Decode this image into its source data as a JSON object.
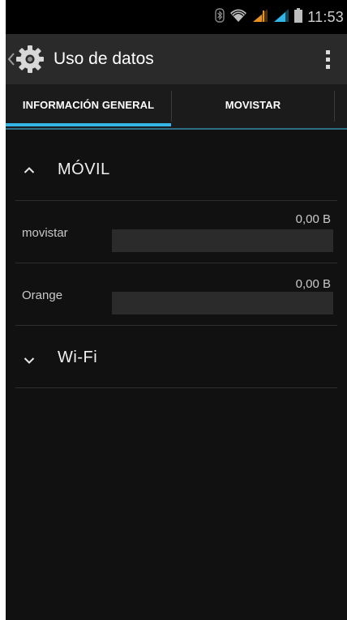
{
  "status_bar": {
    "time": "11:53",
    "icons": [
      "bluetooth-icon",
      "wifi-icon",
      "signal-icon",
      "signal-icon",
      "battery-icon"
    ],
    "colors": {
      "signal_orange": "#e8921e",
      "signal_blue": "#33b5e5"
    }
  },
  "action_bar": {
    "title": "Uso de datos",
    "up_icon": "chevron-left-icon",
    "app_icon": "gear-icon",
    "overflow_icon": "overflow-menu-icon"
  },
  "tabs": [
    {
      "label": "INFORMACIÓN GENERAL",
      "selected": true
    },
    {
      "label": "MOVISTAR",
      "selected": false
    }
  ],
  "sections": {
    "movil": {
      "label": "MÓVIL",
      "expanded": true,
      "icon": "chevron-up-icon"
    },
    "wifi": {
      "label": "Wi-Fi",
      "expanded": false,
      "icon": "chevron-down-icon"
    }
  },
  "usage": [
    {
      "name": "movistar",
      "value": "0,00 B",
      "fill": 0
    },
    {
      "name": "Orange",
      "value": "0,00 B",
      "fill": 0
    }
  ],
  "colors": {
    "accent": "#33b5e5",
    "background": "#111111",
    "action_bar": "#2a2a2a"
  }
}
